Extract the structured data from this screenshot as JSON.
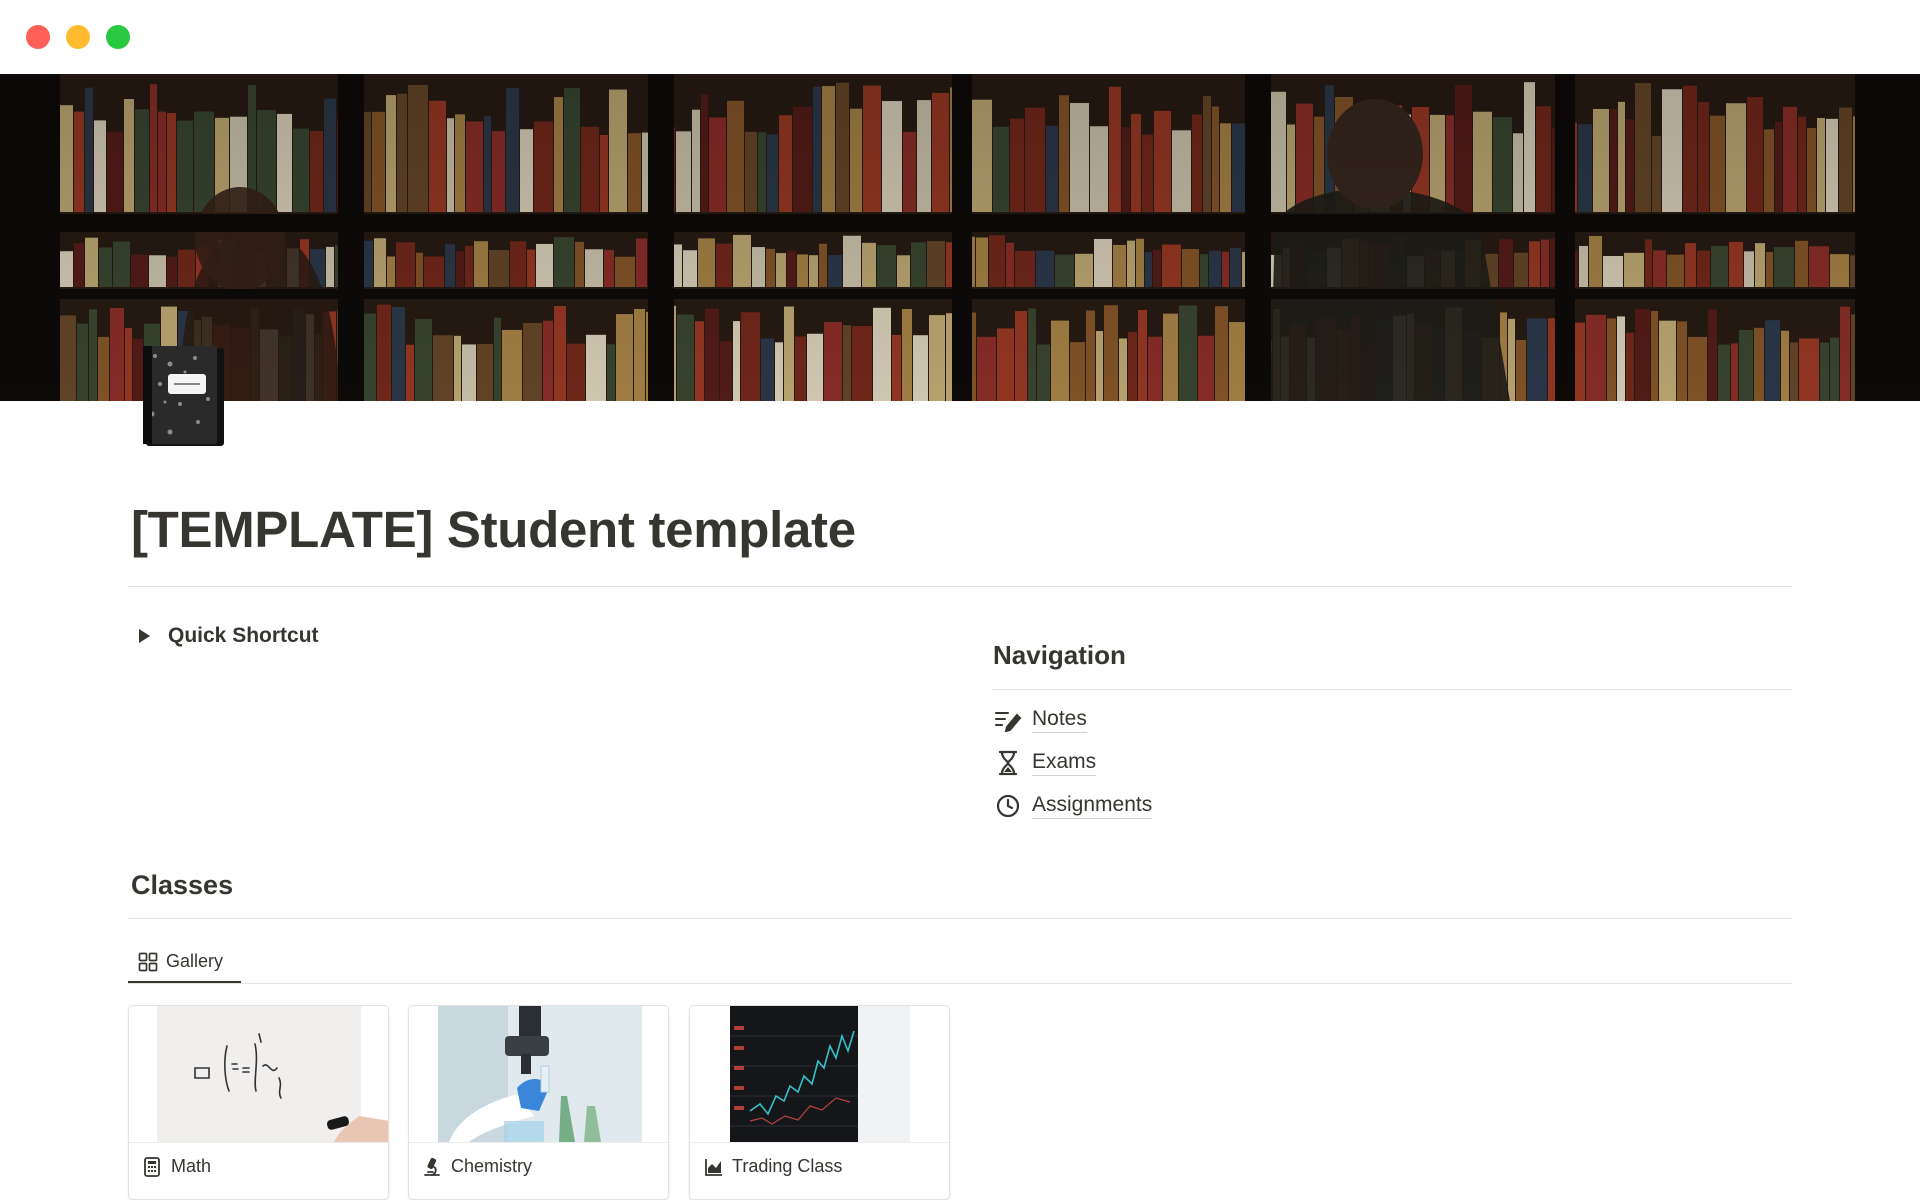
{
  "window": {
    "controls": [
      "close",
      "minimize",
      "maximize"
    ]
  },
  "cover": {
    "description_icon": "bookshop-cover-image"
  },
  "page": {
    "icon": "composition-notebook-icon",
    "title": "[TEMPLATE] Student template"
  },
  "toggle": {
    "label": "Quick Shortcut"
  },
  "navigation": {
    "heading": "Navigation",
    "items": [
      {
        "label": "Notes",
        "icon": "notes-pen-icon"
      },
      {
        "label": "Exams",
        "icon": "hourglass-icon"
      },
      {
        "label": "Assignments",
        "icon": "clock-icon"
      }
    ]
  },
  "classes": {
    "heading": "Classes",
    "view_tab": {
      "label": "Gallery",
      "icon": "gallery-grid-icon"
    },
    "cards": [
      {
        "title": "Math",
        "icon": "calculator-icon"
      },
      {
        "title": "Chemistry",
        "icon": "microscope-icon"
      },
      {
        "title": "Trading Class",
        "icon": "chart-icon"
      }
    ]
  },
  "colors": {
    "text": "#37352f",
    "divider": "#e3e2e0",
    "close": "#fe5f57",
    "minimize": "#febc2e",
    "maximize": "#28c840"
  }
}
